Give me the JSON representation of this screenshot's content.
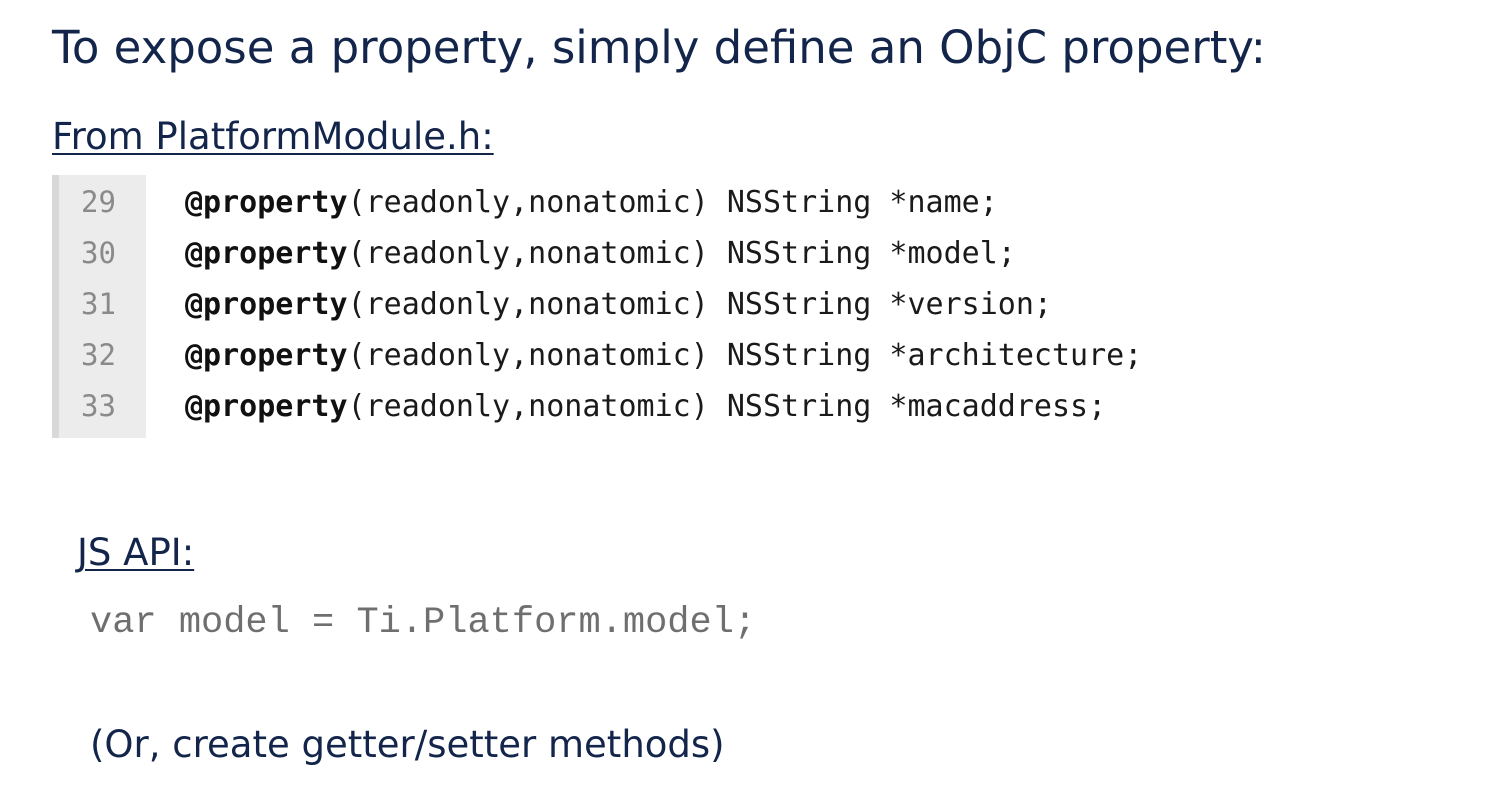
{
  "slide": {
    "heading": "To expose a property, simply define an ObjC property:",
    "from_label": "From PlatformModule.h:",
    "code_lines": [
      {
        "number": "29",
        "keyword": "@property",
        "rest": "(readonly,nonatomic) NSString *name;"
      },
      {
        "number": "30",
        "keyword": "@property",
        "rest": "(readonly,nonatomic) NSString *model;"
      },
      {
        "number": "31",
        "keyword": "@property",
        "rest": "(readonly,nonatomic) NSString *version;"
      },
      {
        "number": "32",
        "keyword": "@property",
        "rest": "(readonly,nonatomic) NSString *architecture;"
      },
      {
        "number": "33",
        "keyword": "@property",
        "rest": "(readonly,nonatomic) NSString *macaddress;"
      }
    ],
    "js_label": "JS API:",
    "js_code": "var model = Ti.Platform.model;",
    "note": "(Or, create getter/setter methods)"
  },
  "colors": {
    "text_navy": "#13254a",
    "gutter_bg": "#ececec",
    "line_number": "#8a8a8a",
    "js_code": "#6f6f6f"
  }
}
